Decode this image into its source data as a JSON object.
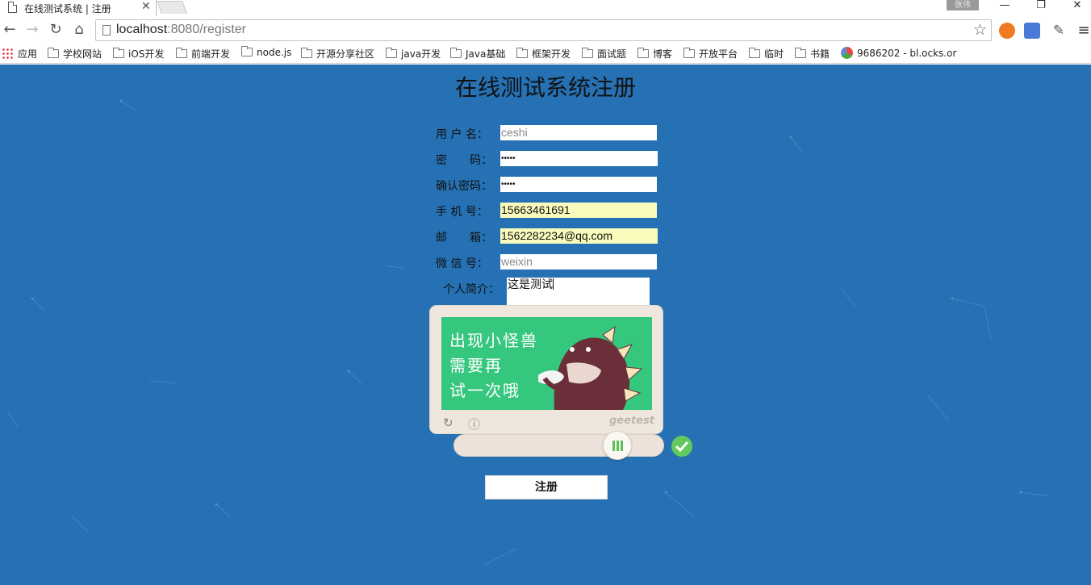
{
  "browser": {
    "tab_title": "在线测试系统 | 注册",
    "profile_name": "张伟",
    "url_host": "localhost",
    "url_rest": ":8080/register",
    "bookmarks": [
      {
        "label": "应用"
      },
      {
        "label": "学校网站"
      },
      {
        "label": "iOS开发"
      },
      {
        "label": "前端开发"
      },
      {
        "label": "node.js"
      },
      {
        "label": "开源分享社区"
      },
      {
        "label": "java开发"
      },
      {
        "label": "Java基础"
      },
      {
        "label": "框架开发"
      },
      {
        "label": "面试题"
      },
      {
        "label": "博客"
      },
      {
        "label": "开放平台"
      },
      {
        "label": "临时"
      },
      {
        "label": "书籍"
      },
      {
        "label": "9686202 - bl.ocks.or"
      }
    ]
  },
  "form": {
    "title": "在线测试系统注册",
    "fields": [
      {
        "label": "用 户 名：",
        "value": "ceshi"
      },
      {
        "label": "密　　码：",
        "value": "•••••"
      },
      {
        "label": "确认密码：",
        "value": "•••••"
      },
      {
        "label": "手 机 号：",
        "value": "15663461691"
      },
      {
        "label": "邮　　箱：",
        "value": "1562282234@qq.com"
      },
      {
        "label": "微 信 号：",
        "value": "weixin"
      }
    ],
    "bio_label": "个人简介：",
    "bio_value": "这是测试",
    "submit_label": "注册"
  },
  "captcha": {
    "message": "出现小怪兽\n需要再\n试一次哦",
    "brand": "geetest",
    "slider_progress": 0.76,
    "status": "success"
  },
  "colors": {
    "page_bg": "#2571b4",
    "captcha_green": "#35c77e",
    "autofill": "#fafcbd",
    "success": "#63c95c"
  }
}
